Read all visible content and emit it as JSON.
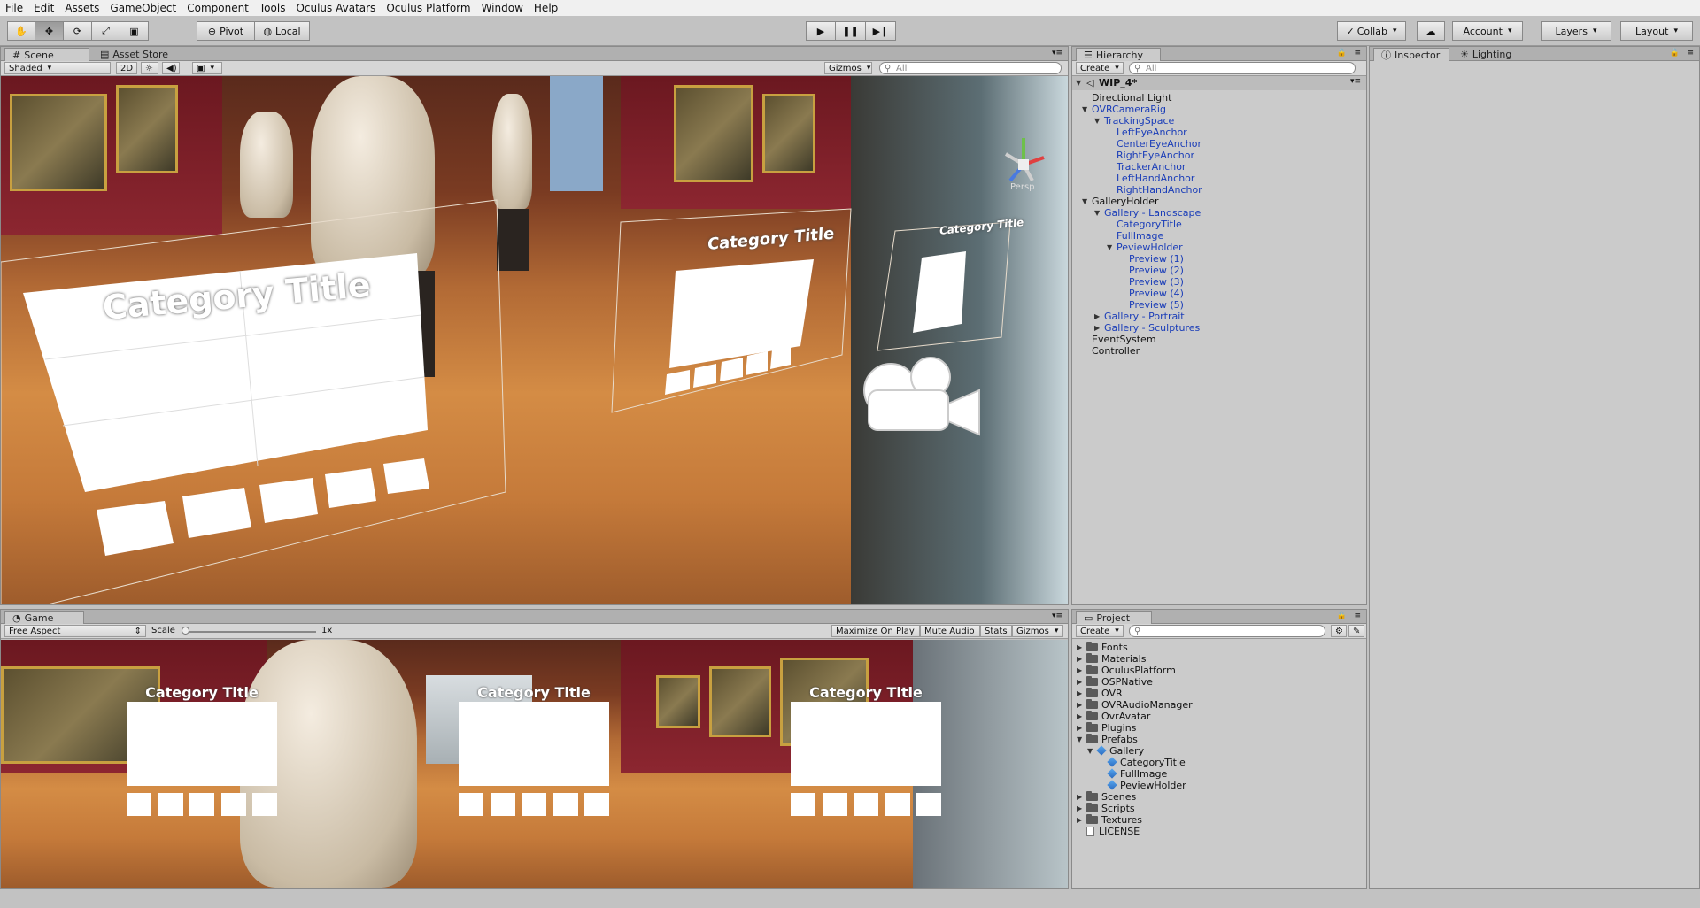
{
  "menu": [
    "File",
    "Edit",
    "Assets",
    "GameObject",
    "Component",
    "Tools",
    "Oculus Avatars",
    "Oculus Platform",
    "Window",
    "Help"
  ],
  "toolbar": {
    "pivot_label": "Pivot",
    "local_label": "Local",
    "collab_label": "Collab",
    "account_label": "Account",
    "layers_label": "Layers",
    "layout_label": "Layout"
  },
  "scene": {
    "tabs": [
      "Scene",
      "Asset Store"
    ],
    "shading_mode": "Shaded",
    "mode_2d": "2D",
    "gizmos_label": "Gizmos",
    "search_placeholder": "All",
    "persp_label": "Persp",
    "panel_titles": [
      "Category Title",
      "Category Title",
      "Category Title"
    ]
  },
  "game": {
    "tab": "Game",
    "aspect": "Free Aspect",
    "scale_label": "Scale",
    "scale_value": "1x",
    "buttons": [
      "Maximize On Play",
      "Mute Audio",
      "Stats",
      "Gizmos"
    ],
    "card_titles": [
      "Category Title",
      "Category Title",
      "Category Title"
    ]
  },
  "hierarchy": {
    "tab": "Hierarchy",
    "create_label": "Create",
    "search_placeholder": "All",
    "scene_name": "WIP_4*",
    "items": [
      {
        "label": "Directional Light",
        "depth": 1,
        "blue": false,
        "arrow": ""
      },
      {
        "label": "OVRCameraRig",
        "depth": 1,
        "blue": true,
        "arrow": "down"
      },
      {
        "label": "TrackingSpace",
        "depth": 2,
        "blue": true,
        "arrow": "down"
      },
      {
        "label": "LeftEyeAnchor",
        "depth": 3,
        "blue": true,
        "arrow": ""
      },
      {
        "label": "CenterEyeAnchor",
        "depth": 3,
        "blue": true,
        "arrow": ""
      },
      {
        "label": "RightEyeAnchor",
        "depth": 3,
        "blue": true,
        "arrow": ""
      },
      {
        "label": "TrackerAnchor",
        "depth": 3,
        "blue": true,
        "arrow": ""
      },
      {
        "label": "LeftHandAnchor",
        "depth": 3,
        "blue": true,
        "arrow": ""
      },
      {
        "label": "RightHandAnchor",
        "depth": 3,
        "blue": true,
        "arrow": ""
      },
      {
        "label": "GalleryHolder",
        "depth": 1,
        "blue": false,
        "arrow": "down"
      },
      {
        "label": "Gallery - Landscape",
        "depth": 2,
        "blue": true,
        "arrow": "down"
      },
      {
        "label": "CategoryTitle",
        "depth": 3,
        "blue": true,
        "arrow": ""
      },
      {
        "label": "FullImage",
        "depth": 3,
        "blue": true,
        "arrow": ""
      },
      {
        "label": "PeviewHolder",
        "depth": 3,
        "blue": true,
        "arrow": "down"
      },
      {
        "label": "Preview (1)",
        "depth": 4,
        "blue": true,
        "arrow": ""
      },
      {
        "label": "Preview (2)",
        "depth": 4,
        "blue": true,
        "arrow": ""
      },
      {
        "label": "Preview (3)",
        "depth": 4,
        "blue": true,
        "arrow": ""
      },
      {
        "label": "Preview (4)",
        "depth": 4,
        "blue": true,
        "arrow": ""
      },
      {
        "label": "Preview (5)",
        "depth": 4,
        "blue": true,
        "arrow": ""
      },
      {
        "label": "Gallery - Portrait",
        "depth": 2,
        "blue": true,
        "arrow": "right"
      },
      {
        "label": "Gallery - Sculptures",
        "depth": 2,
        "blue": true,
        "arrow": "right"
      },
      {
        "label": "EventSystem",
        "depth": 1,
        "blue": false,
        "arrow": ""
      },
      {
        "label": "Controller",
        "depth": 1,
        "blue": false,
        "arrow": ""
      }
    ]
  },
  "inspector": {
    "tabs": [
      "Inspector",
      "Lighting"
    ]
  },
  "project": {
    "tab": "Project",
    "create_label": "Create",
    "items": [
      {
        "label": "Fonts",
        "depth": 0,
        "type": "folder",
        "arrow": "right"
      },
      {
        "label": "Materials",
        "depth": 0,
        "type": "folder",
        "arrow": "right"
      },
      {
        "label": "OculusPlatform",
        "depth": 0,
        "type": "folder",
        "arrow": "right"
      },
      {
        "label": "OSPNative",
        "depth": 0,
        "type": "folder",
        "arrow": "right"
      },
      {
        "label": "OVR",
        "depth": 0,
        "type": "folder",
        "arrow": "right"
      },
      {
        "label": "OVRAudioManager",
        "depth": 0,
        "type": "folder",
        "arrow": "right"
      },
      {
        "label": "OvrAvatar",
        "depth": 0,
        "type": "folder",
        "arrow": "right"
      },
      {
        "label": "Plugins",
        "depth": 0,
        "type": "folder",
        "arrow": "right"
      },
      {
        "label": "Prefabs",
        "depth": 0,
        "type": "folder",
        "arrow": "down"
      },
      {
        "label": "Gallery",
        "depth": 1,
        "type": "prefab",
        "arrow": "down"
      },
      {
        "label": "CategoryTitle",
        "depth": 2,
        "type": "prefab",
        "arrow": ""
      },
      {
        "label": "FullImage",
        "depth": 2,
        "type": "prefab",
        "arrow": ""
      },
      {
        "label": "PeviewHolder",
        "depth": 2,
        "type": "prefab",
        "arrow": ""
      },
      {
        "label": "Scenes",
        "depth": 0,
        "type": "folder",
        "arrow": "right"
      },
      {
        "label": "Scripts",
        "depth": 0,
        "type": "folder",
        "arrow": "right"
      },
      {
        "label": "Textures",
        "depth": 0,
        "type": "folder",
        "arrow": "right"
      },
      {
        "label": "LICENSE",
        "depth": 0,
        "type": "file",
        "arrow": ""
      }
    ]
  }
}
